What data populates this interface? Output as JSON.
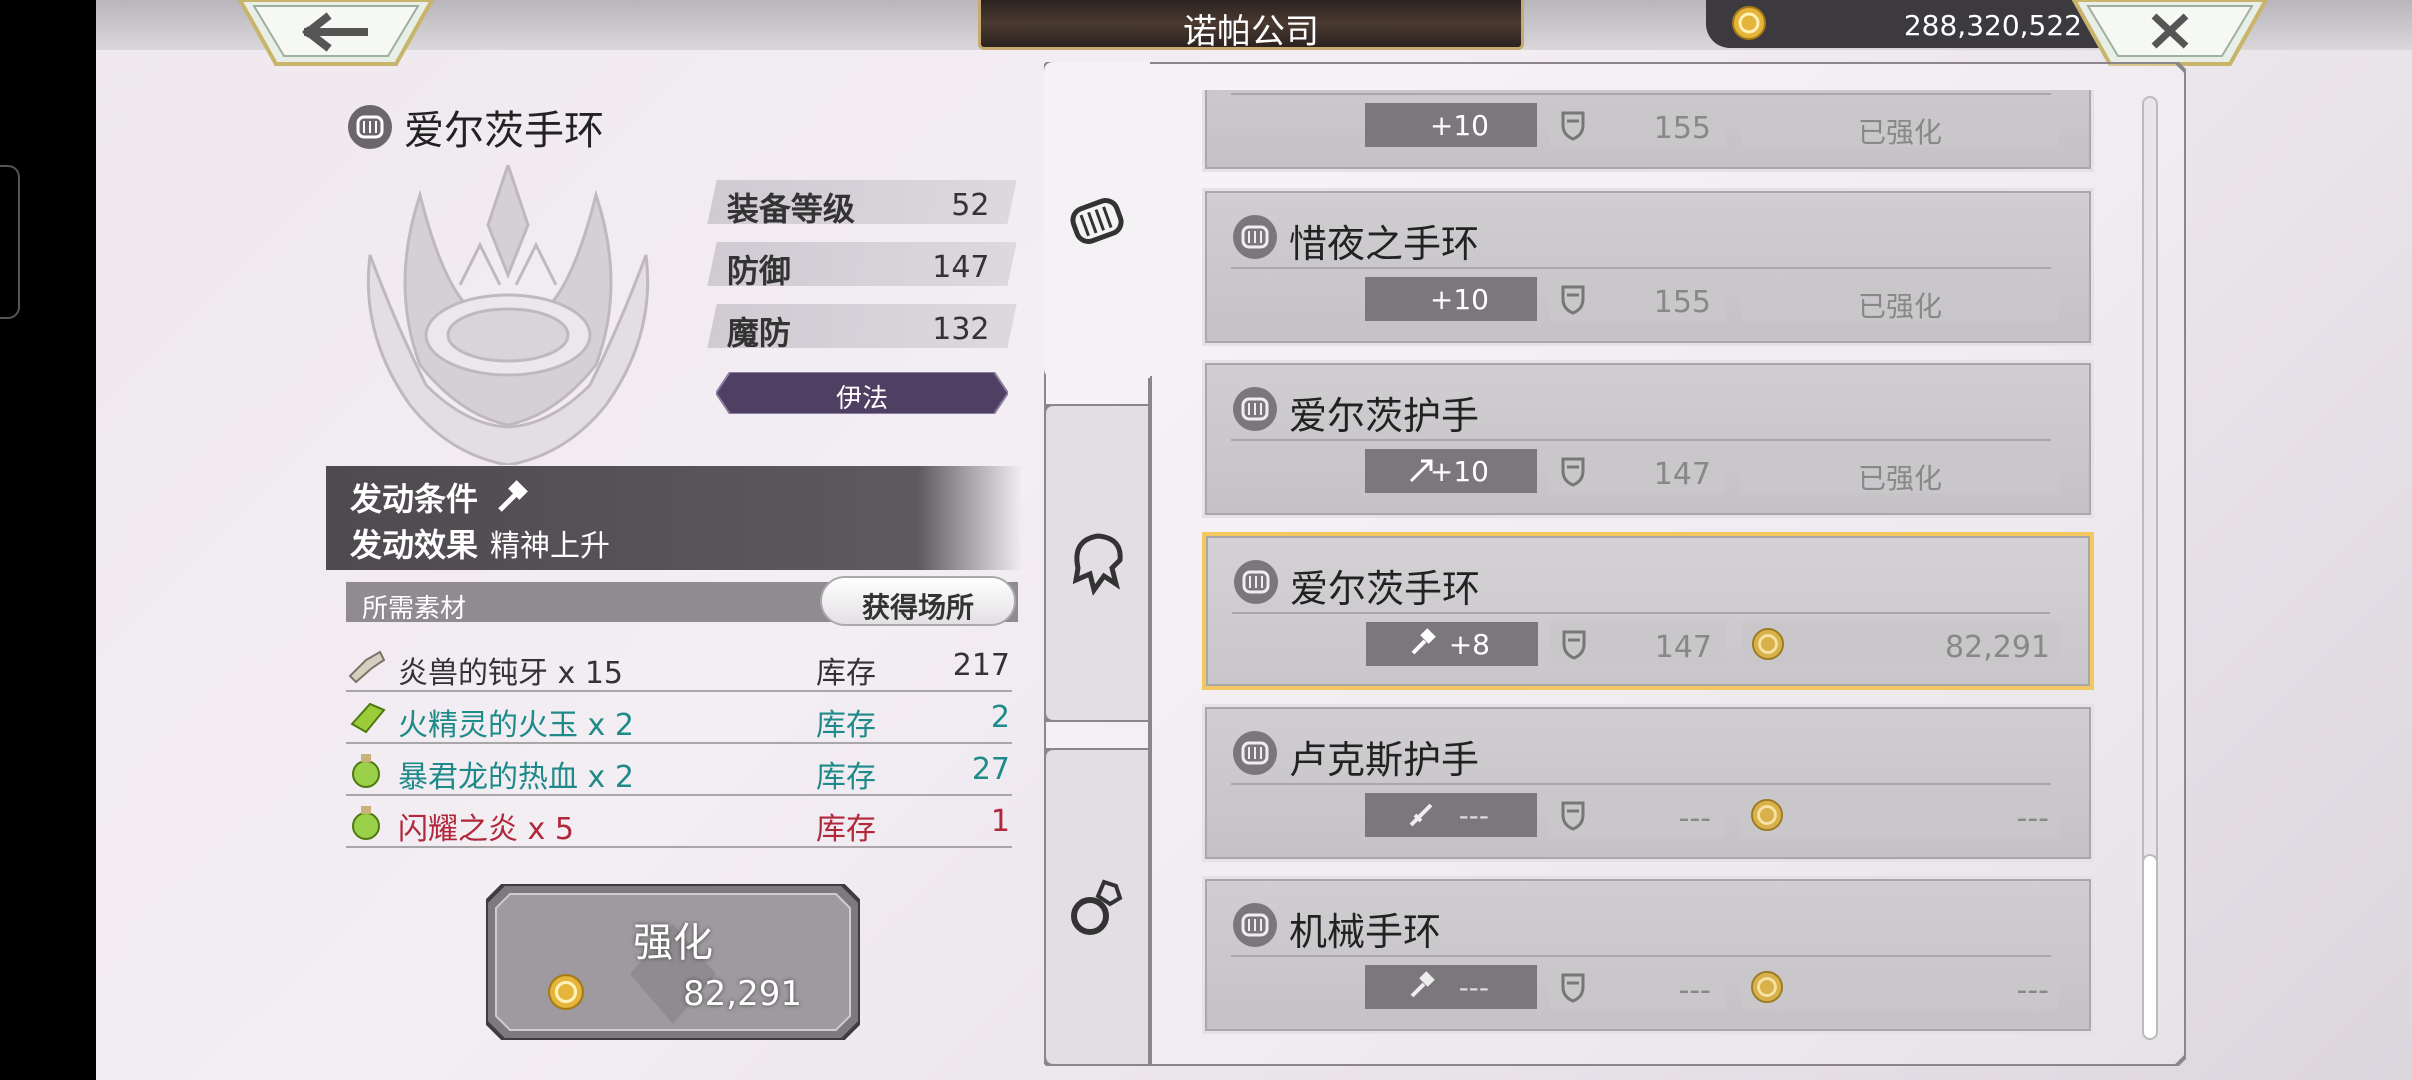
{
  "header": {
    "title": "诺帕公司",
    "currency": "288,320,522"
  },
  "item": {
    "name": "爱尔茨手环",
    "stats": [
      {
        "label": "装备等级",
        "value": "52"
      },
      {
        "label": "防御",
        "value": "147"
      },
      {
        "label": "魔防",
        "value": "132"
      }
    ],
    "tag": "伊法",
    "condition_label": "发动条件",
    "effect_label": "发动效果",
    "effect_value": "精神上升"
  },
  "materials": {
    "header": "所需素材",
    "obtain_button": "获得场所",
    "rows": [
      {
        "name": "炎兽的钝牙 x 15",
        "stock_label": "库存",
        "count": "217",
        "color": "#333333"
      },
      {
        "name": "火精灵的火玉 x 2",
        "stock_label": "库存",
        "count": "2",
        "color": "#1f8a8a"
      },
      {
        "name": "暴君龙的热血 x 2",
        "stock_label": "库存",
        "count": "27",
        "color": "#1f8a8a"
      },
      {
        "name": "闪耀之炎 x 5",
        "stock_label": "库存",
        "count": "1",
        "color": "#b0283a"
      }
    ]
  },
  "enhance": {
    "label": "强化",
    "cost": "82,291"
  },
  "equipment_list": [
    {
      "name": "",
      "level": "+10",
      "defense": "155",
      "status": "已强化",
      "selected": false
    },
    {
      "name": "惜夜之手环",
      "level": "+10",
      "defense": "155",
      "status": "已强化",
      "selected": false
    },
    {
      "name": "爱尔茨护手",
      "level": "+10",
      "defense": "147",
      "status": "已强化",
      "selected": false
    },
    {
      "name": "爱尔茨手环",
      "level": "+8",
      "defense": "147",
      "cost": "82,291",
      "selected": true
    },
    {
      "name": "卢克斯护手",
      "level": "---",
      "defense": "---",
      "cost": "---",
      "selected": false
    },
    {
      "name": "机械手环",
      "level": "---",
      "defense": "---",
      "cost": "---",
      "selected": false
    }
  ],
  "colors": {
    "accent_gold": "#f2c860",
    "tag_purple": "#4f3f63",
    "panel_dark": "#4e4a4f"
  }
}
